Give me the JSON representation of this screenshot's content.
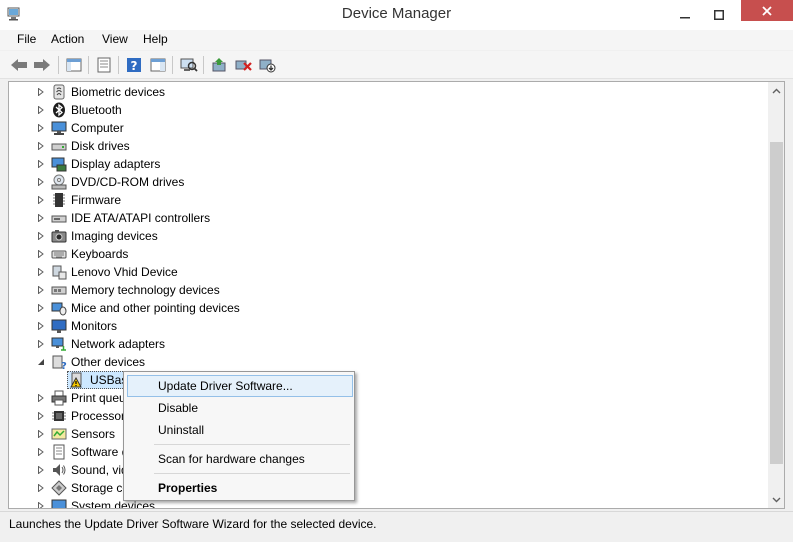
{
  "window": {
    "title": "Device Manager"
  },
  "menu": {
    "file": "File",
    "action": "Action",
    "view": "View",
    "help": "Help"
  },
  "toolbar": {
    "icons": [
      "back-arrow-icon",
      "forward-arrow-icon",
      "show-hide-tree-icon",
      "properties-icon",
      "help-icon",
      "action-pane-icon",
      "monitor-scan-icon",
      "update-driver-icon",
      "uninstall-icon",
      "disable-device-icon"
    ]
  },
  "tree": {
    "items": [
      {
        "label": "Biometric devices",
        "icon": "biometric-icon"
      },
      {
        "label": "Bluetooth",
        "icon": "bluetooth-icon"
      },
      {
        "label": "Computer",
        "icon": "computer-icon"
      },
      {
        "label": "Disk drives",
        "icon": "disk-drive-icon"
      },
      {
        "label": "Display adapters",
        "icon": "display-adapter-icon"
      },
      {
        "label": "DVD/CD-ROM drives",
        "icon": "dvd-drive-icon"
      },
      {
        "label": "Firmware",
        "icon": "firmware-icon"
      },
      {
        "label": "IDE ATA/ATAPI controllers",
        "icon": "ide-controller-icon"
      },
      {
        "label": "Imaging devices",
        "icon": "camera-icon"
      },
      {
        "label": "Keyboards",
        "icon": "keyboard-icon"
      },
      {
        "label": "Lenovo Vhid Device",
        "icon": "hid-device-icon"
      },
      {
        "label": "Memory technology devices",
        "icon": "memory-card-icon"
      },
      {
        "label": "Mice and other pointing devices",
        "icon": "mouse-icon"
      },
      {
        "label": "Monitors",
        "icon": "monitor-icon"
      },
      {
        "label": "Network adapters",
        "icon": "network-adapter-icon"
      },
      {
        "label": "Other devices",
        "icon": "unknown-device-icon"
      },
      {
        "label": "USBas",
        "icon": "warning-device-icon"
      },
      {
        "label": "Print queu",
        "icon": "printer-icon"
      },
      {
        "label": "Processor",
        "icon": "processor-icon"
      },
      {
        "label": "Sensors",
        "icon": "sensor-icon"
      },
      {
        "label": "Software d",
        "icon": "software-device-icon"
      },
      {
        "label": "Sound, vid",
        "icon": "sound-icon"
      },
      {
        "label": "Storage co",
        "icon": "storage-controller-icon"
      },
      {
        "label": "System devices",
        "icon": "system-device-icon"
      }
    ]
  },
  "context_menu": {
    "update": "Update Driver Software...",
    "disable": "Disable",
    "uninstall": "Uninstall",
    "scan": "Scan for hardware changes",
    "properties": "Properties"
  },
  "status": {
    "text": "Launches the Update Driver Software Wizard for the selected device."
  },
  "colors": {
    "close_button": "#c74f4e",
    "highlight": "#e5f1fb",
    "highlight_border": "#94c0e8",
    "selection": "#cde8ff"
  }
}
